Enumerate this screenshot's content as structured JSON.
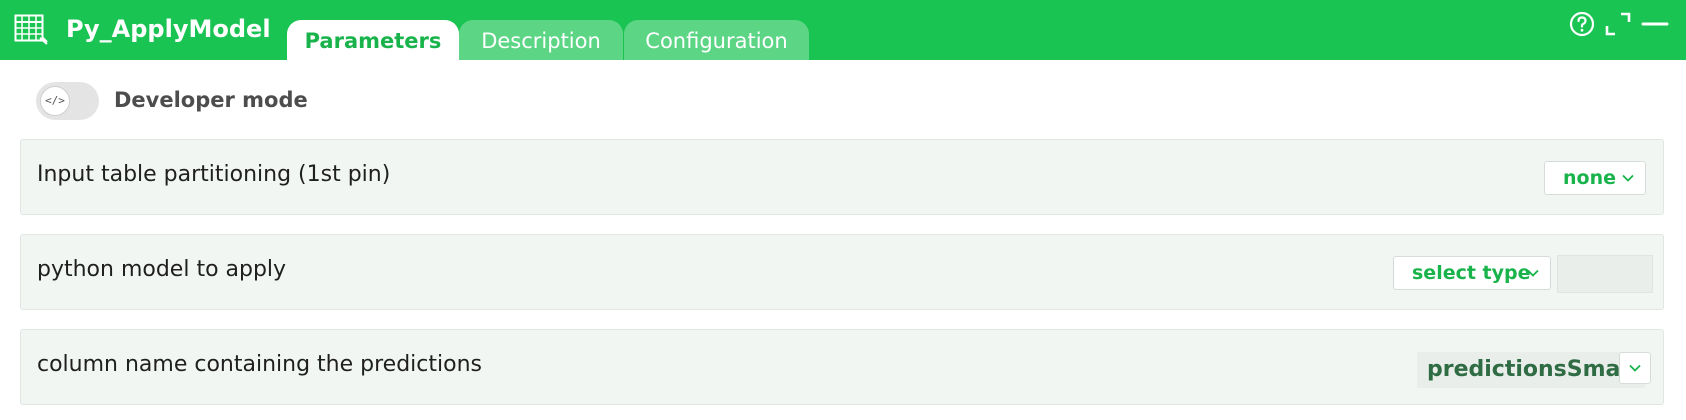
{
  "window": {
    "title": "Py_ApplyModel",
    "app_icon": "table-icon",
    "controls": [
      "help-icon",
      "expand-icon",
      "minimize-icon"
    ]
  },
  "tabs": [
    {
      "label": "Parameters",
      "active": true
    },
    {
      "label": "Description",
      "active": false
    },
    {
      "label": "Configuration",
      "active": false
    }
  ],
  "developer_mode": {
    "label": "Developer mode",
    "toggle_icon": "</>",
    "enabled": false
  },
  "parameters": [
    {
      "label": "Input table partitioning (1st pin)",
      "dropdown_value": "none"
    },
    {
      "label": "python model to apply",
      "dropdown_value": "select type",
      "input_value": ""
    },
    {
      "label": "column name containing the predictions",
      "combo_value": "predictionsSmall"
    }
  ],
  "colors": {
    "accent": "#19c452",
    "accent_text": "#19b34c",
    "row_background": "#f2f6f3",
    "value_text": "#2f6b43"
  }
}
